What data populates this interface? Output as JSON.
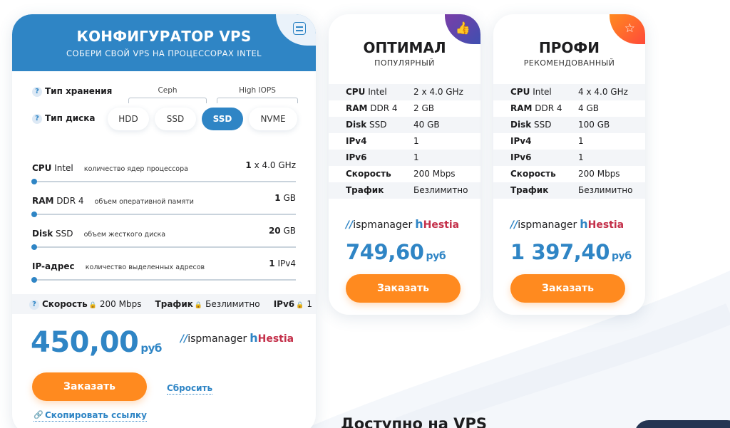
{
  "colors": {
    "accent": "#2f85c5",
    "order_button": "#ff8a1f",
    "hestia": "#c4304a",
    "plan1_corner": "#4a3fa6",
    "plan2_corner": "#ff6a2a"
  },
  "configurator": {
    "title": "КОНФИГУРАТОР VPS",
    "subtitle": "СОБЕРИ СВОЙ VPS НА ПРОЦЕССОРАХ INTEL",
    "corner_icon": "settings-sliders-icon",
    "storage_type_label": "Тип хранения",
    "disk_type_label": "Тип диска",
    "storage_groups": [
      "Ceph",
      "High IOPS"
    ],
    "disk_options": [
      "HDD",
      "SSD",
      "SSD",
      "NVME"
    ],
    "selected_disk_index": 2,
    "sliders": [
      {
        "name": "CPU",
        "qualifier": "Intel",
        "desc": "количество ядер процессора",
        "value": "1",
        "unit": "x 4.0 GHz",
        "level": 0
      },
      {
        "name": "RAM",
        "qualifier": "DDR 4",
        "desc": "объем оперативной памяти",
        "value": "1",
        "unit": "GB",
        "level": 0
      },
      {
        "name": "Disk",
        "qualifier": "SSD",
        "desc": "объем жесткого диска",
        "value": "20",
        "unit": "GB",
        "level": 0
      },
      {
        "name": "IP-адрес",
        "qualifier": "",
        "desc": "количество выделенных адресов",
        "value": "1",
        "unit": "IPv4",
        "level": 0
      }
    ],
    "specs": {
      "speed_label": "Скорость",
      "speed_value": "200 Mbps",
      "traffic_label": "Трафик",
      "traffic_value": "Безлимитно",
      "ipv6_label": "IPv6",
      "ipv6_value": "1"
    },
    "price": "450,00",
    "currency": "руб",
    "order_label": "Заказать",
    "reset_label": "Сбросить",
    "copy_link_label": "Скопировать ссылку"
  },
  "logo": {
    "isp_text": "ispmanager",
    "hestia_text": "Hestia"
  },
  "plans": [
    {
      "name": "ОПТИМАЛ",
      "tag": "ПОПУЛЯРНЫЙ",
      "corner_icon": "thumbs-up-icon",
      "specs": [
        {
          "key": "CPU",
          "suffix": "Intel",
          "value": "2 x 4.0 GHz"
        },
        {
          "key": "RAM",
          "suffix": "DDR 4",
          "value": "2 GB"
        },
        {
          "key": "Disk",
          "suffix": "SSD",
          "value": "40 GB"
        },
        {
          "key": "IPv4",
          "suffix": "",
          "value": "1"
        },
        {
          "key": "IPv6",
          "suffix": "",
          "value": "1"
        },
        {
          "key": "Скорость",
          "suffix": "",
          "value": "200 Mbps"
        },
        {
          "key": "Трафик",
          "suffix": "",
          "value": "Безлимитно"
        }
      ],
      "price": "749,60",
      "currency": "руб",
      "order_label": "Заказать"
    },
    {
      "name": "ПРОФИ",
      "tag": "РЕКОМЕНДОВАННЫЙ",
      "corner_icon": "star-icon",
      "specs": [
        {
          "key": "CPU",
          "suffix": "Intel",
          "value": "4 x 4.0 GHz"
        },
        {
          "key": "RAM",
          "suffix": "DDR 4",
          "value": "4 GB"
        },
        {
          "key": "Disk",
          "suffix": "SSD",
          "value": "100 GB"
        },
        {
          "key": "IPv4",
          "suffix": "",
          "value": "1"
        },
        {
          "key": "IPv6",
          "suffix": "",
          "value": "1"
        },
        {
          "key": "Скорость",
          "suffix": "",
          "value": "200 Mbps"
        },
        {
          "key": "Трафик",
          "suffix": "",
          "value": "Безлимитно"
        }
      ],
      "price": "1 397,40",
      "currency": "руб",
      "order_label": "Заказать"
    }
  ],
  "section_heading": "Доступно на VPS"
}
